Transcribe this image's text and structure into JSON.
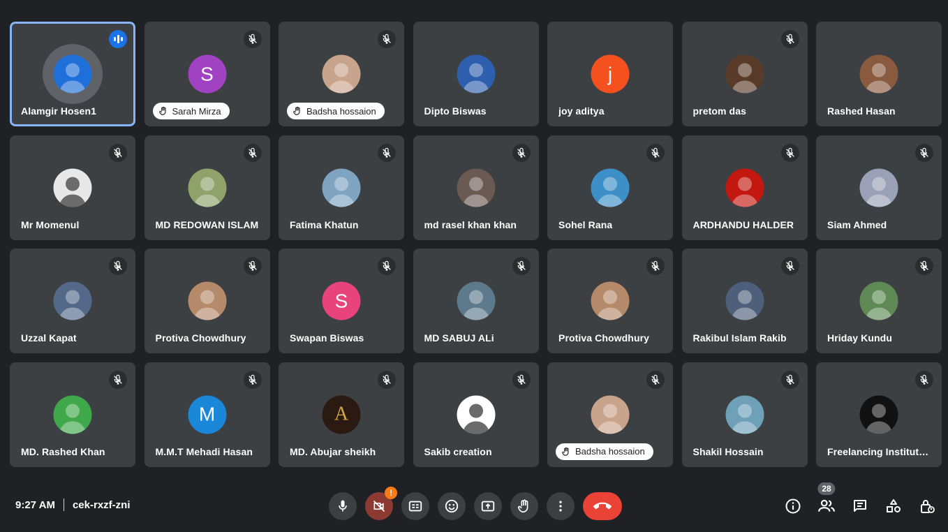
{
  "participants": [
    {
      "name": "Alamgir Hosen1",
      "avatar": "photo",
      "bg": "#1e6fd9",
      "speaking": true
    },
    {
      "name": "Sarah Mirza",
      "avatar": "S",
      "bg": "#a142c2",
      "hand_raised": true
    },
    {
      "name": "Badsha hossaion",
      "avatar": "photo",
      "bg": "#c9a48c",
      "hand_raised": true
    },
    {
      "name": "Dipto Biswas",
      "avatar": "photo",
      "bg": "#2e5fae"
    },
    {
      "name": "joy aditya",
      "avatar": "j",
      "bg": "#f4511e"
    },
    {
      "name": "pretom das",
      "avatar": "photo",
      "bg": "#5a3b2a"
    },
    {
      "name": "Rashed Hasan",
      "avatar": "photo",
      "bg": "#8a5a3f"
    },
    {
      "name": "Mr Momenul",
      "avatar": "photo",
      "bg": "#e8e8e8"
    },
    {
      "name": "MD REDOWAN ISLAM",
      "avatar": "photo",
      "bg": "#8fa26a"
    },
    {
      "name": "Fatima Khatun",
      "avatar": "photo",
      "bg": "#7ea4c2"
    },
    {
      "name": "md rasel khan khan",
      "avatar": "photo",
      "bg": "#6b5a52"
    },
    {
      "name": "Sohel Rana",
      "avatar": "photo",
      "bg": "#3d8fc7"
    },
    {
      "name": "ARDHANDU HALDER",
      "avatar": "photo",
      "bg": "#c2180f"
    },
    {
      "name": "Siam Ahmed",
      "avatar": "photo",
      "bg": "#9aa0b5"
    },
    {
      "name": "Uzzal Kapat",
      "avatar": "photo",
      "bg": "#54698a"
    },
    {
      "name": "Protiva Chowdhury",
      "avatar": "photo",
      "bg": "#b58a6a"
    },
    {
      "name": "Swapan Biswas",
      "avatar": "S",
      "bg": "#e8437a"
    },
    {
      "name": "MD SABUJ ALi",
      "avatar": "photo",
      "bg": "#5c7a8c"
    },
    {
      "name": "Protiva Chowdhury",
      "avatar": "photo",
      "bg": "#b58a6a"
    },
    {
      "name": "Rakibul Islam Rakib",
      "avatar": "photo",
      "bg": "#4d5f7a"
    },
    {
      "name": "Hriday Kundu",
      "avatar": "photo",
      "bg": "#5f8a55"
    },
    {
      "name": "MD. Rashed Khan",
      "avatar": "photo",
      "bg": "#3fa84a"
    },
    {
      "name": "M.M.T Mehadi Hasan",
      "avatar": "M",
      "bg": "#1a87d8"
    },
    {
      "name": "MD. Abujar sheikh",
      "avatar": "A",
      "bg": "#2a1a12",
      "fg": "#d7a63f"
    },
    {
      "name": "Sakib creation",
      "avatar": "photo",
      "bg": "#ffffff"
    },
    {
      "name": "Badsha hossaion",
      "avatar": "photo",
      "bg": "#c9a48c",
      "hand_raised": true
    },
    {
      "name": "Shakil Hossain",
      "avatar": "photo",
      "bg": "#6ea0b8"
    },
    {
      "name": "Freelancing Institute…",
      "avatar": "photo",
      "bg": "#111111"
    }
  ],
  "bottom_bar": {
    "time": "9:27 AM",
    "meeting_code": "cek-rxzf-zni",
    "camera_alert": "!",
    "people_count": "28"
  },
  "icons": {
    "muted": "mic-off-icon",
    "speaking": "audio-level-icon",
    "hand": "raised-hand-icon"
  }
}
